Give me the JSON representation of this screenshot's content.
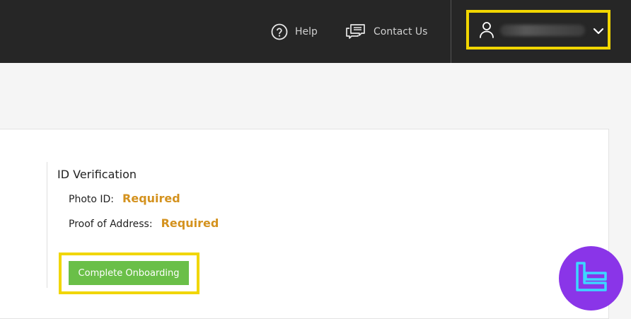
{
  "header": {
    "help_label": "Help",
    "contact_label": "Contact Us",
    "help_icon": "help-circle-icon",
    "contact_icon": "chat-bubbles-icon",
    "user_icon": "user-icon",
    "dropdown_icon": "chevron-down-icon"
  },
  "verification": {
    "title": "ID Verification",
    "photo_id_label": "Photo ID:",
    "photo_id_status": "Required",
    "address_label": "Proof of Address:",
    "address_status": "Required"
  },
  "actions": {
    "complete_onboarding_label": "Complete Onboarding"
  },
  "colors": {
    "topbar": "#262626",
    "highlight": "#f1d600",
    "status_required": "#d4921e",
    "button_green": "#6abf48",
    "watermark": "#8a35e8"
  }
}
